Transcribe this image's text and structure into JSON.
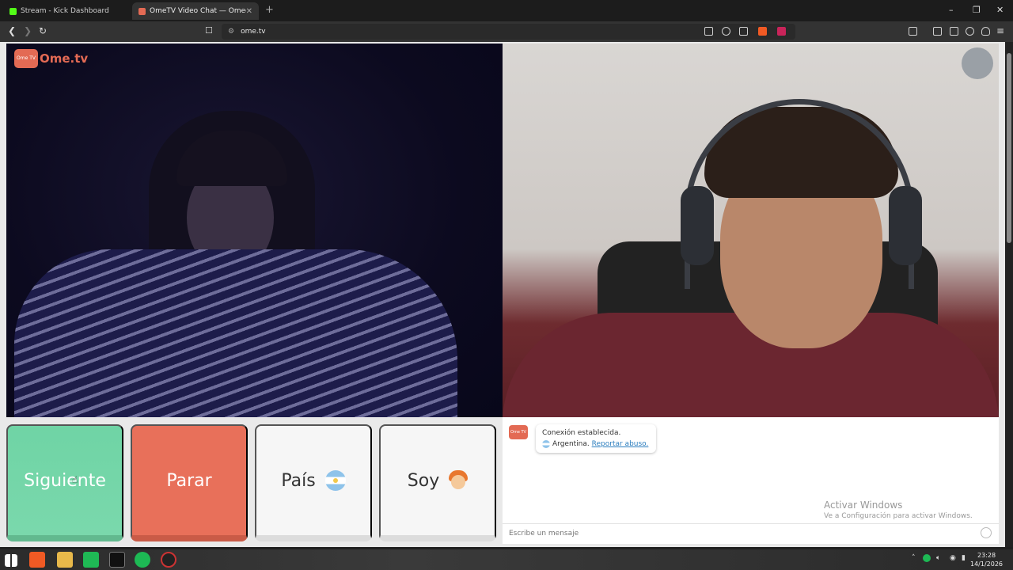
{
  "browser": {
    "tabs": [
      {
        "label": "Stream - Kick Dashboard",
        "active": false,
        "icon": "kick-icon",
        "color": "#53fc18"
      },
      {
        "label": "OmeTV Video Chat — Omegl",
        "active": true,
        "icon": "ometv-icon",
        "color": "#e36a54"
      }
    ],
    "new_tab": "+",
    "url": "ome.tv",
    "window_controls": {
      "minimize": "–",
      "restore": "❐",
      "close": "✕"
    }
  },
  "page": {
    "logo_text": "Ome.tv",
    "logo_badge": "Ome TV",
    "buttons": {
      "next": "Siguiente",
      "stop": "Parar",
      "country": "País",
      "gender": "Soy"
    },
    "chat": {
      "badge": "Ome TV",
      "status_line": "Conexión establecida.",
      "country": "Argentina.",
      "report_link": "Reportar abuso.",
      "input_placeholder": "Escribe un mensaje"
    },
    "watermark": {
      "line1": "Activar Windows",
      "line2": "Ve a Configuración para activar Windows."
    }
  },
  "taskbar": {
    "time": "23:28",
    "date": "14/1/2026"
  },
  "colors": {
    "next": "#6fd4a5",
    "stop": "#e8705a",
    "brand": "#e36a54",
    "link": "#2e7fbf"
  }
}
